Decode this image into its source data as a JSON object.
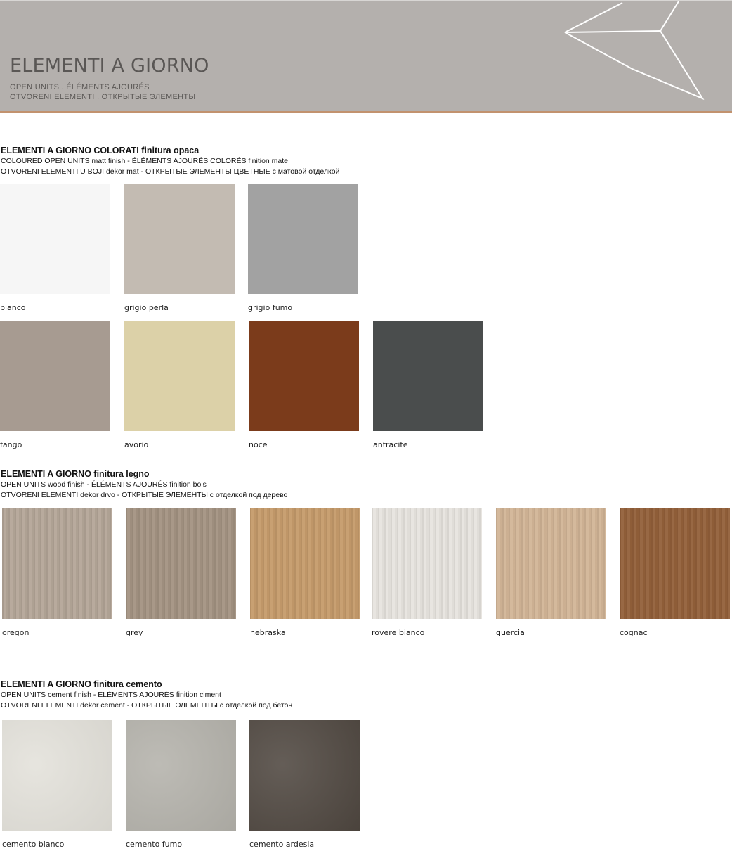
{
  "header": {
    "title": "ELEMENTI A GIORNO",
    "subtitle_1": "OPEN UNITS . ÉLÉMENTS AJOURÉS",
    "subtitle_2": "OTVORENI ELEMENTI . ОТКРЫТЫЕ ЭЛЕМЕНТЫ"
  },
  "sections": [
    {
      "title_bold": "ELEMENTI A GIORNO COLORATI finitura opaca",
      "line_2": "COLOURED OPEN UNITS matt finish - ÉLÉMENTS AJOURÉS COLORÉS finition mate",
      "line_3": "OTVORENI ELEMENTI U BOJI dekor mat - ОТКРЫТЫЕ ЭЛЕМЕНТЫ ЦВЕТНЫЕ с матовой отделкой",
      "swatches": [
        {
          "label": "bianco",
          "color": "#f6f6f6"
        },
        {
          "label": "grigio perla",
          "color": "#c3bbb2"
        },
        {
          "label": "grigio fumo",
          "color": "#a2a2a2"
        },
        {
          "label": "fango",
          "color": "#a79b91"
        },
        {
          "label": "avorio",
          "color": "#dcd1a8"
        },
        {
          "label": "noce",
          "color": "#7b3b1b"
        },
        {
          "label": "antracite",
          "color": "#4a4d4d"
        }
      ]
    },
    {
      "title_bold": "ELEMENTI A GIORNO finitura legno",
      "line_2": "OPEN UNITS wood finish - ÉLÉMENTS AJOURÉS finition bois",
      "line_3": "OTVORENI ELEMENTI dekor drvo - ОТКРЫТЫЕ ЭЛЕМЕНТЫ с отделкой под дерево",
      "swatches": [
        {
          "label": "oregon",
          "color": "#b4a698"
        },
        {
          "label": "grey",
          "color": "#a39382"
        },
        {
          "label": "nebraska",
          "color": "#c59b6b"
        },
        {
          "label": "rovere bianco",
          "color": "#e7e4df"
        },
        {
          "label": "quercia",
          "color": "#d2b597"
        },
        {
          "label": "cognac",
          "color": "#93603a"
        }
      ]
    },
    {
      "title_bold": "ELEMENTI A GIORNO finitura cemento",
      "line_2": "OPEN UNITS cement finish - ÉLÉMENTS AJOURÉS finition ciment",
      "line_3": "OTVORENI ELEMENTI dekor cement - ОТКРЫТЫЕ ЭЛЕМЕНТЫ с отделкой под бетон",
      "swatches": [
        {
          "label": "cemento bianco",
          "color": "#e3e1da"
        },
        {
          "label": "cemento fumo",
          "color": "#b4b2ab"
        },
        {
          "label": "cemento ardesia",
          "color": "#4f4740"
        }
      ]
    }
  ]
}
